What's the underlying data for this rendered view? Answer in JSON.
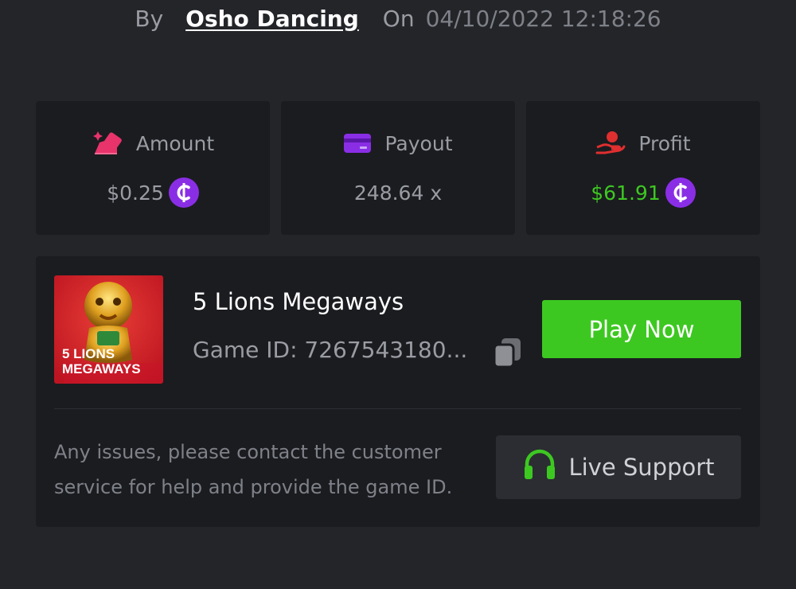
{
  "byline": {
    "by_label": "By",
    "username": "Osho Dancing",
    "on_label": "On",
    "datetime": "04/10/2022 12:18:26"
  },
  "stats": {
    "amount": {
      "label": "Amount",
      "value": "$0.25",
      "icon": "amount-icon",
      "icon_color": "#e8336b"
    },
    "payout": {
      "label": "Payout",
      "value": "248.64 x",
      "icon": "card-icon",
      "icon_color": "#8a2ee6"
    },
    "profit": {
      "label": "Profit",
      "value": "$61.91",
      "icon": "profit-hand-icon",
      "icon_color": "#e02f2f",
      "value_color": "#3dc821"
    },
    "coin_symbol": "₵",
    "coin_color": "#8a2ee6"
  },
  "game": {
    "thumbnail_text_line1": "5 LIONS",
    "thumbnail_text_line2": "MEGAWAYS",
    "title": "5 Lions Megaways",
    "game_id": "Game ID: 7267543180...",
    "play_label": "Play Now",
    "play_color": "#3dc821"
  },
  "support": {
    "help_text": "Any issues, please contact the customer service for help and provide the game ID.",
    "button_label": "Live Support",
    "icon": "headset-icon",
    "icon_color": "#3dc821"
  }
}
